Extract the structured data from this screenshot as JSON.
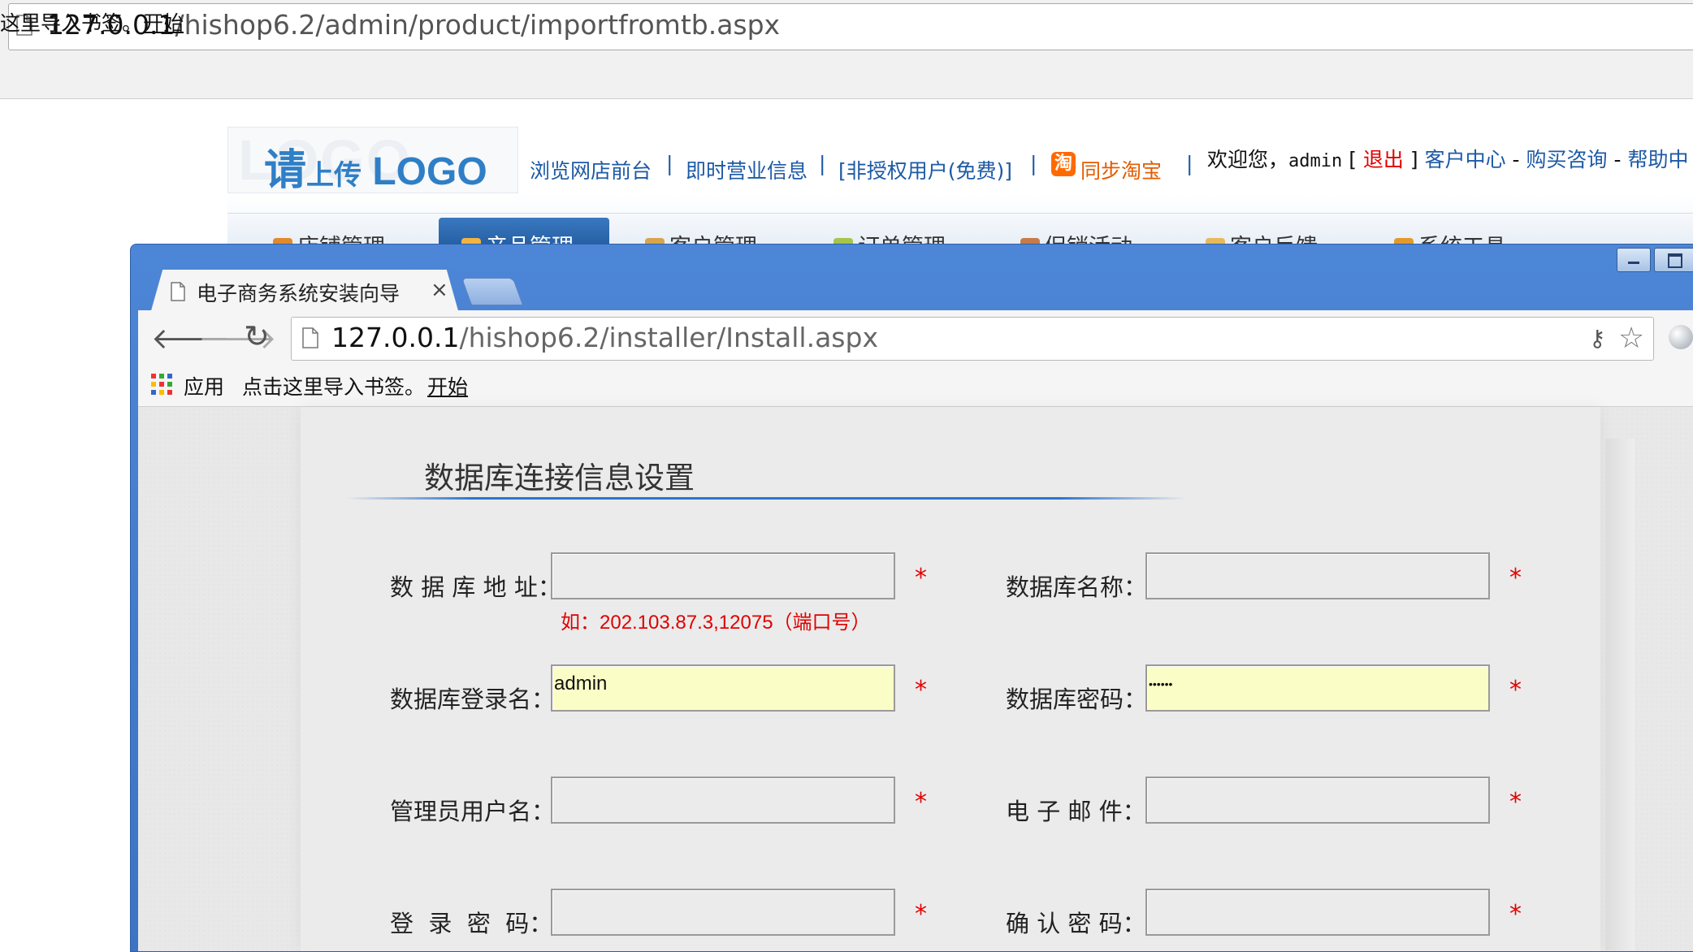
{
  "background_browser": {
    "url_host": "127.0.0.1",
    "url_path": "/hishop6.2/admin/product/importfromtb.aspx",
    "bookmarks": {
      "import_label": "这里导入书签。",
      "start_label": "开始"
    }
  },
  "admin_header": {
    "logo": {
      "ghost_text": "LOGO",
      "text_main": "请",
      "text_small": "上传",
      "text_logo": "LOGO"
    },
    "links": {
      "storefront": "浏览网店前台",
      "business_info": "即时营业信息",
      "license": "[非授权用户(免费)]",
      "sync_taobao": "同步淘宝",
      "taobao_icon": "淘"
    },
    "welcome": {
      "prefix": "欢迎您，",
      "user": "admin",
      "bracket_open": " [ ",
      "logout": "退出",
      "bracket_close": " ] ",
      "customer_center": "客户中心",
      "dash1": " - ",
      "purchase_consult": "购买咨询",
      "dash2": " - ",
      "help": "帮助中"
    },
    "nav": [
      "店铺管理",
      "产品管理",
      "客户管理",
      "订单管理",
      "促销活动",
      "客户反馈",
      "系统工具"
    ]
  },
  "chrome": {
    "tab_title": "电子商务系统安装向导",
    "tab_close": "×",
    "url_host": "127.0.0.1",
    "url_path": "/hishop6.2/installer/Install.aspx",
    "bookmarks": {
      "apps_label": "应用",
      "import_label": "点击这里导入书签。",
      "start_label": "开始"
    }
  },
  "installer": {
    "section_title": "数据库连接信息设置",
    "required_mark": "*",
    "hint": "如：202.103.87.3,12075（端口号）",
    "fields": {
      "db_address": {
        "label": "数 据 库 地 址：",
        "value": ""
      },
      "db_name": {
        "label": "数据库名称：",
        "value": ""
      },
      "db_user": {
        "label": "数据库登录名：",
        "value": "admin"
      },
      "db_password": {
        "label": "数据库密码：",
        "value": "••••••"
      },
      "admin_user": {
        "label": "管理员用户名：",
        "value": ""
      },
      "email": {
        "label": "电 子 邮 件：",
        "value": ""
      },
      "login_password": {
        "label": "登  录  密  码：",
        "value": ""
      },
      "confirm_password": {
        "label": "确 认 密 码：",
        "value": ""
      }
    }
  }
}
